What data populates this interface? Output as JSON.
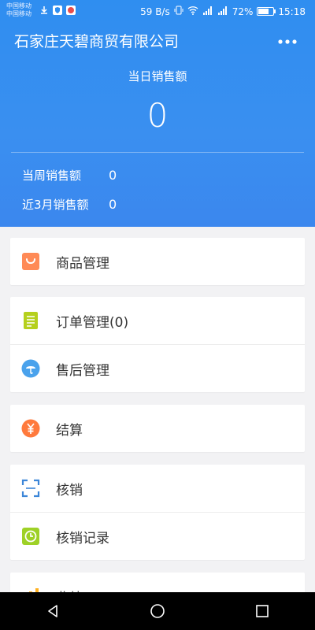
{
  "status_bar": {
    "carrier_lines": [
      "中国移动",
      "中国移动"
    ],
    "speed": "59 B/s",
    "battery_text": "72%",
    "battery_level": 0.72,
    "time": "15:18"
  },
  "header": {
    "company_name": "石家庄天碧商贸有限公司",
    "more_icon": "more-horizontal-icon",
    "today_label": "当日销售额",
    "today_value": "0",
    "stats": [
      {
        "label": "当周销售额",
        "value": "0"
      },
      {
        "label": "近3月销售额",
        "value": "0"
      }
    ]
  },
  "menu": [
    {
      "label": "商品管理",
      "icon": "shopping-bag-icon",
      "color": "#ff8a56"
    },
    {
      "label": "订单管理(0)",
      "icon": "order-list-icon",
      "color": "#b5d01d"
    },
    {
      "label": "售后管理",
      "icon": "umbrella-icon",
      "color": "#4aa2ec"
    },
    {
      "label": "结算",
      "icon": "yuan-icon",
      "color": "#ff7a3d"
    },
    {
      "label": "核销",
      "icon": "scan-icon",
      "color": "#3c86d8"
    },
    {
      "label": "核销记录",
      "icon": "clock-record-icon",
      "color": "#9ed127"
    },
    {
      "label": "业绩",
      "icon": "chart-icon",
      "color": "#ffb020"
    }
  ]
}
